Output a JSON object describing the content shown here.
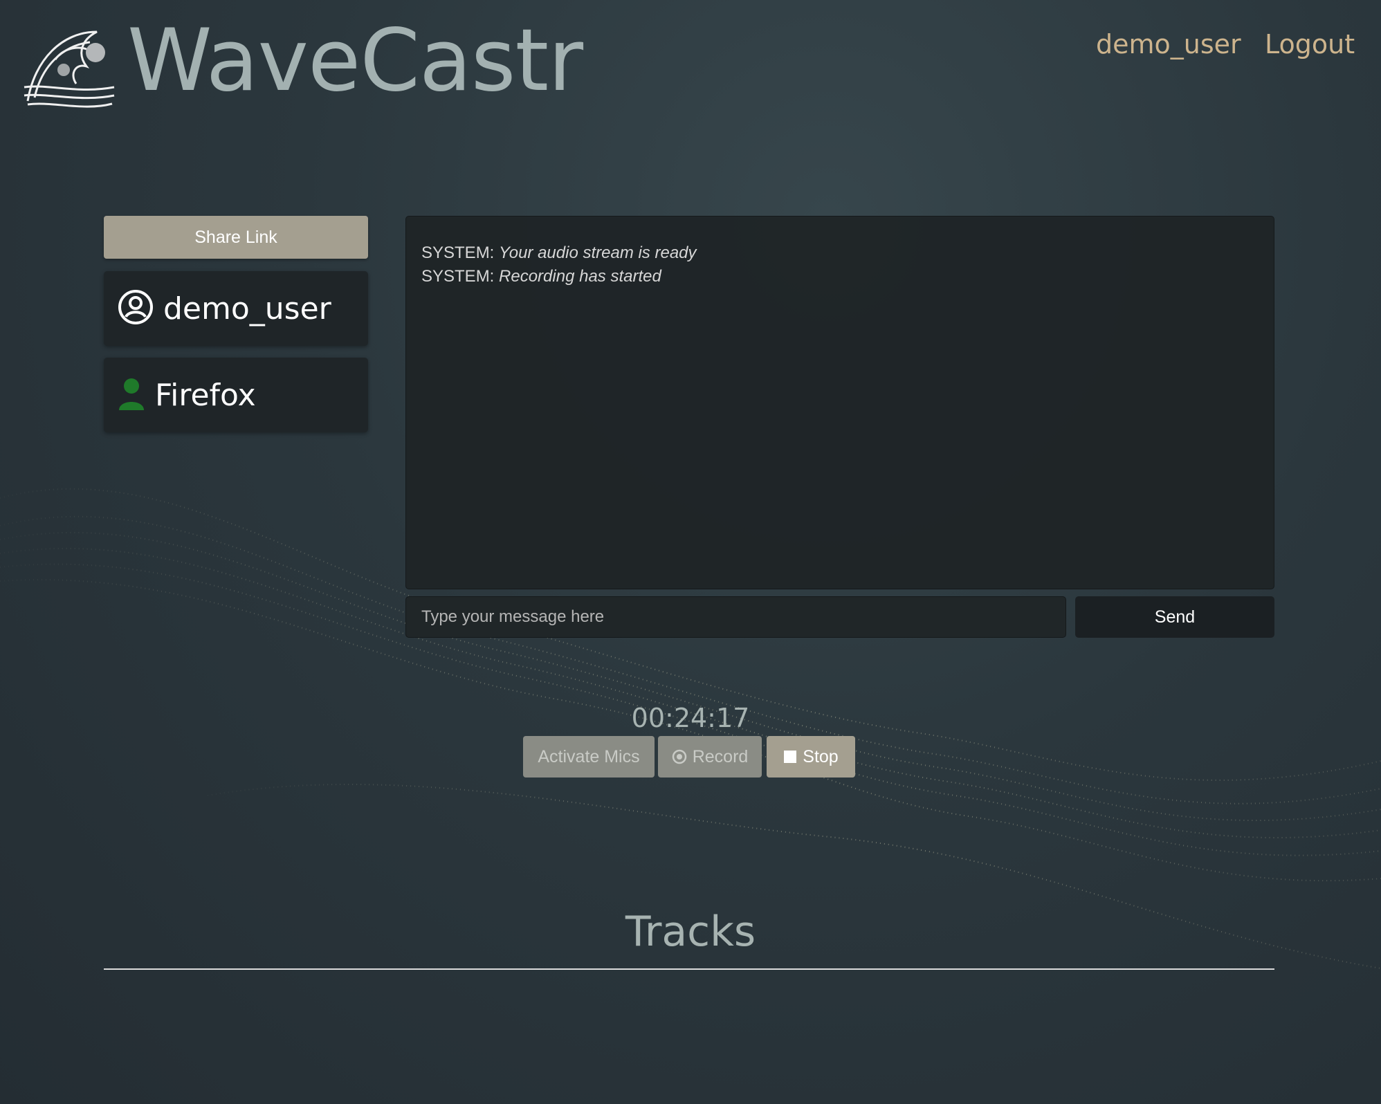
{
  "header": {
    "brand": "WaveCastr",
    "nav": {
      "user": "demo_user",
      "logout": "Logout"
    }
  },
  "sidebar": {
    "share_label": "Share Link",
    "users": [
      {
        "name": "demo_user",
        "icon": "user-circle-icon"
      },
      {
        "name": "Firefox",
        "icon": "user-icon",
        "icon_color": "#1f7a2a"
      }
    ]
  },
  "chat": {
    "messages": [
      {
        "sender": "SYSTEM:",
        "text": "Your audio stream is ready"
      },
      {
        "sender": "SYSTEM:",
        "text": "Recording has started"
      }
    ],
    "input_placeholder": "Type your message here",
    "send_label": "Send"
  },
  "recording": {
    "timer": "00:24:17",
    "activate_label": "Activate Mics",
    "record_label": "Record",
    "stop_label": "Stop"
  },
  "tracks": {
    "heading": "Tracks"
  },
  "colors": {
    "accent": "#cdb48d",
    "button_primary": "#a49f90",
    "button_disabled": "#8a8c85",
    "panel": "#1f2528",
    "brand_text": "#a3b1b1"
  }
}
